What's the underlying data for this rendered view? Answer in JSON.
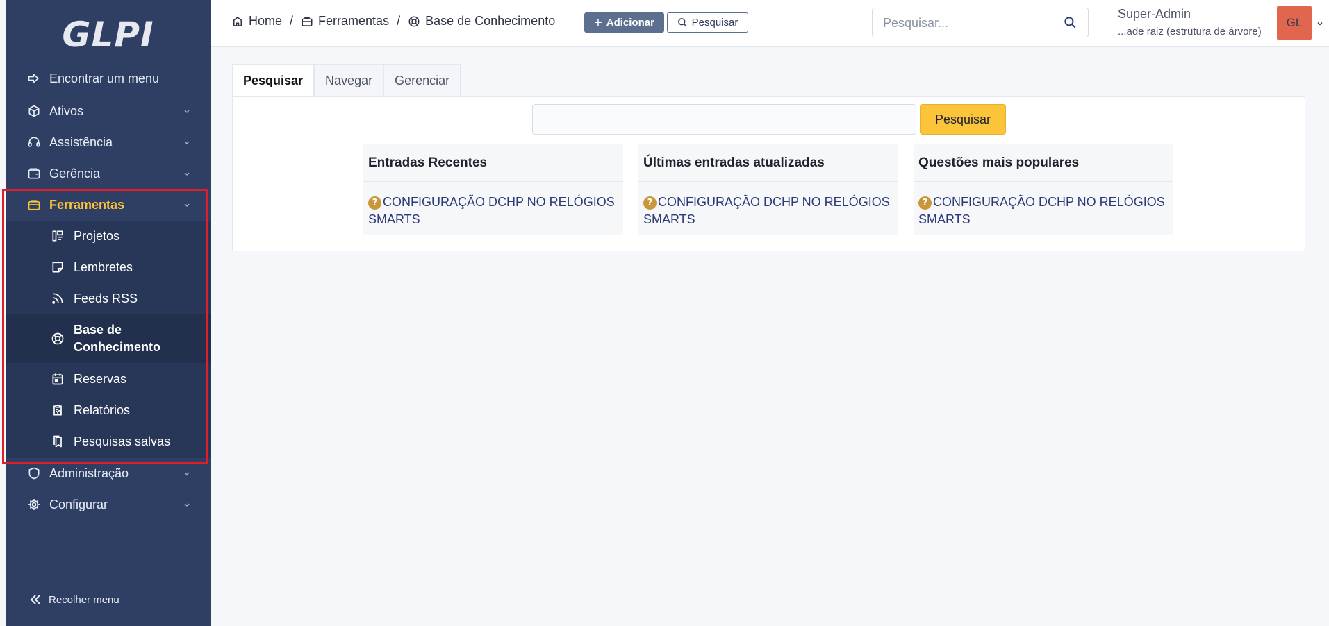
{
  "app": {
    "logo": "GLPI"
  },
  "sidebar": {
    "find_menu": "Encontrar um menu",
    "items": [
      {
        "label": "Ativos"
      },
      {
        "label": "Assistência"
      },
      {
        "label": "Gerência"
      },
      {
        "label": "Ferramentas"
      },
      {
        "label": "Administração"
      },
      {
        "label": "Configurar"
      }
    ],
    "sub_items": [
      {
        "label": "Projetos"
      },
      {
        "label": "Lembretes"
      },
      {
        "label": "Feeds RSS"
      },
      {
        "label": "Base de Conhecimento"
      },
      {
        "label": "Reservas"
      },
      {
        "label": "Relatórios"
      },
      {
        "label": "Pesquisas salvas"
      }
    ],
    "collapse": "Recolher menu"
  },
  "header": {
    "breadcrumb": [
      "Home",
      "Ferramentas",
      "Base de Conhecimento"
    ],
    "separator": "/",
    "add_button": "Adicionar",
    "search_button": "Pesquisar",
    "search_placeholder": "Pesquisar...",
    "user_name": "Super-Admin",
    "user_entity": "...ade raiz (estrutura de árvore)",
    "avatar_initials": "GL"
  },
  "main": {
    "tabs": [
      {
        "label": "Pesquisar"
      },
      {
        "label": "Navegar"
      },
      {
        "label": "Gerenciar"
      }
    ],
    "search_input_value": "",
    "search_button": "Pesquisar",
    "columns": [
      {
        "title": "Entradas Recentes",
        "items": [
          "CONFIGURAÇÃO DCHP NO RELÓGIOS SMARTS"
        ]
      },
      {
        "title": "Últimas entradas atualizadas",
        "items": [
          "CONFIGURAÇÃO DCHP NO RELÓGIOS SMARTS"
        ]
      },
      {
        "title": "Questões mais populares",
        "items": [
          "CONFIGURAÇÃO DCHP NO RELÓGIOS SMARTS"
        ]
      }
    ],
    "question_icon_glyph": "?"
  },
  "colors": {
    "sidebar_bg": "#2f3f64",
    "accent": "#fcc43b",
    "highlight": "#e11d2a",
    "avatar": "#e0664d"
  }
}
